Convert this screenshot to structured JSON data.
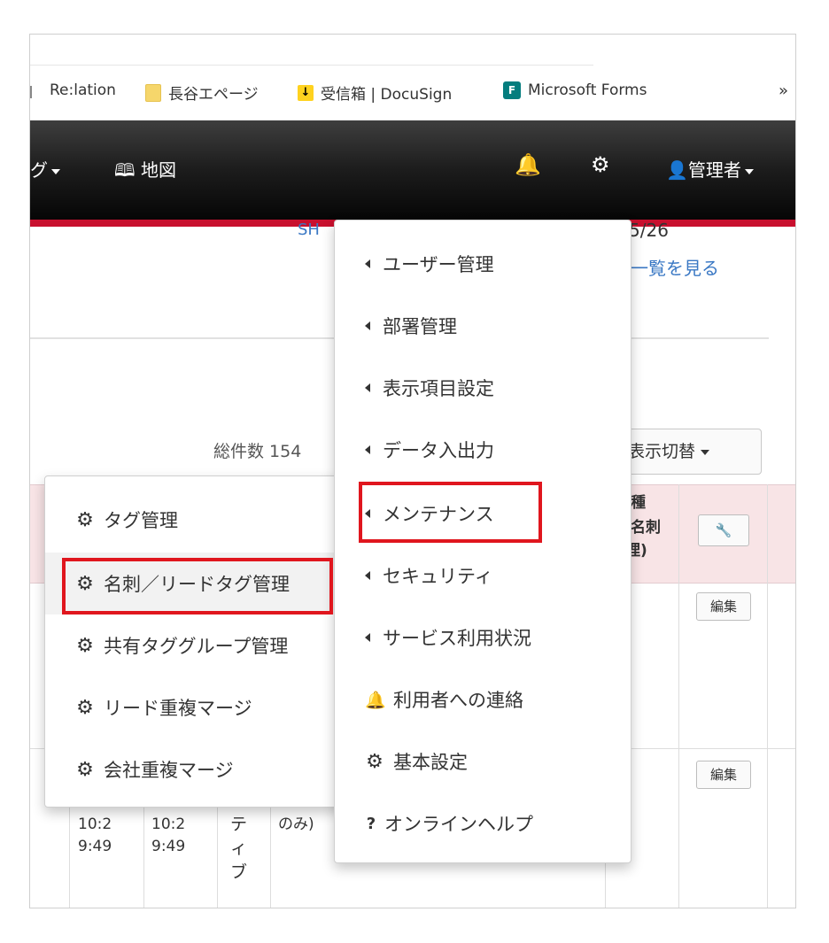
{
  "bookmarks": {
    "items": [
      {
        "label": "Re:lation",
        "icon": "separator"
      },
      {
        "label": "長谷エページ",
        "icon": "folder-icon"
      },
      {
        "label": "受信箱 | DocuSign",
        "icon": "download-icon"
      },
      {
        "label": "Microsoft Forms",
        "icon": "forms-icon"
      }
    ],
    "more": "»"
  },
  "navbar": {
    "tag_partial": "グ",
    "map_label": "地図",
    "map_icon": "🕮",
    "bell_icon": "🔔",
    "gear_icon": "⚙",
    "user_label": "管理者"
  },
  "content": {
    "partial_top_left": "SH",
    "partial_date": "5/26",
    "view_list": "一覧を見る",
    "total_count": "総件数 154",
    "display_toggle": "表示切替",
    "header_right": [
      "種",
      "名刺",
      "理)"
    ],
    "wrench_icon": "🔧",
    "edit_label": "編集",
    "row_cells": [
      "10:2",
      "9:49",
      "10:2",
      "9:49",
      "テ",
      "ィ",
      "ブ",
      "のみ)"
    ]
  },
  "settings_menu": {
    "items": [
      {
        "label": "ユーザー管理",
        "icon": "left-triangle"
      },
      {
        "label": "部署管理",
        "icon": "left-triangle"
      },
      {
        "label": "表示項目設定",
        "icon": "left-triangle"
      },
      {
        "label": "データ入出力",
        "icon": "left-triangle"
      },
      {
        "label": "メンテナンス",
        "icon": "left-triangle"
      },
      {
        "label": "セキュリティ",
        "icon": "left-triangle"
      },
      {
        "label": "サービス利用状況",
        "icon": "left-triangle"
      },
      {
        "label": "利用者への連絡",
        "icon": "bell"
      },
      {
        "label": "基本設定",
        "icon": "gear"
      },
      {
        "label": "オンラインヘルプ",
        "icon": "question"
      }
    ]
  },
  "maintenance_submenu": {
    "items": [
      {
        "label": "タグ管理",
        "icon": "gear"
      },
      {
        "label": "名刺／リードタグ管理",
        "icon": "gear"
      },
      {
        "label": "共有タググループ管理",
        "icon": "gear"
      },
      {
        "label": "リード重複マージ",
        "icon": "gear"
      },
      {
        "label": "会社重複マージ",
        "icon": "gear"
      }
    ]
  },
  "colors": {
    "highlight": "#e0161e",
    "nav_accent": "#c8102e",
    "link": "#3a78c4",
    "table_header_bg": "#f8e4e6"
  }
}
